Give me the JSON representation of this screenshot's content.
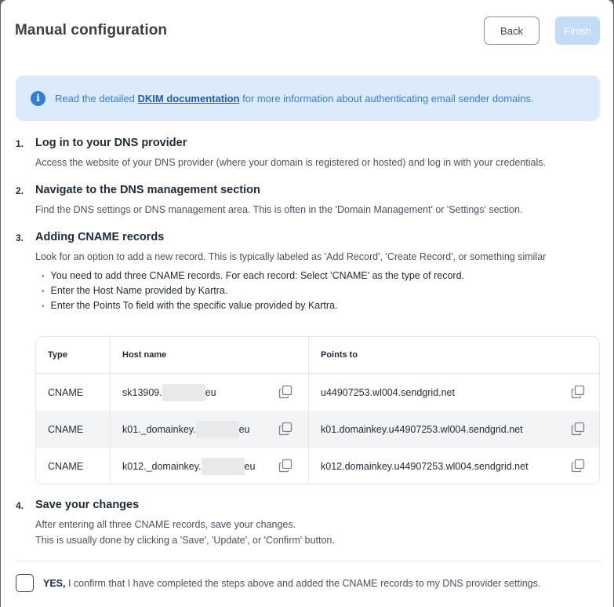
{
  "header": {
    "title": "Manual configuration",
    "back_label": "Back",
    "finish_label": "Finish"
  },
  "info": {
    "icon": "info-icon",
    "before": "Read the detailed ",
    "link": "DKIM documentation",
    "after": " for more information about authenticating email sender domains."
  },
  "steps": [
    {
      "num": "1.",
      "title": "Log in to your DNS provider",
      "desc": "Access the website of your DNS provider (where your domain is registered or hosted) and log in with your credentials."
    },
    {
      "num": "2.",
      "title": "Navigate to the DNS management section",
      "desc": "Find the DNS settings or DNS management area. This is often in the 'Domain Management' or 'Settings' section."
    },
    {
      "num": "3.",
      "title": "Adding CNAME records",
      "desc": "Look for an option to add a new record. This is typically labeled as 'Add Record', 'Create Record', or something similar",
      "bullets": [
        "You need to add three CNAME records. For each record: Select 'CNAME' as the type of record.",
        "Enter the Host Name provided by Kartra.",
        "Enter the Points To field with the specific value provided by Kartra."
      ]
    },
    {
      "num": "4.",
      "title": "Save your changes",
      "desc_lines": [
        "After entering all three CNAME records, save your changes.",
        "This is usually done by clicking a 'Save', 'Update', or 'Confirm' button."
      ]
    }
  ],
  "table": {
    "headers": [
      "Type",
      "Host name",
      "Points to"
    ],
    "rows": [
      {
        "type": "CNAME",
        "host_prefix": "sk13909.",
        "host_suffix": "eu",
        "points_to": "u44907253.wl004.sendgrid.net"
      },
      {
        "type": "CNAME",
        "host_prefix": "k01._domainkey.",
        "host_suffix": "eu",
        "points_to": "k01.domainkey.u44907253.wl004.sendgrid.net"
      },
      {
        "type": "CNAME",
        "host_prefix": "k012._domainkey.",
        "host_suffix": "eu",
        "points_to": "k012.domainkey.u44907253.wl004.sendgrid.net"
      }
    ],
    "copy_icon": "copy-icon"
  },
  "confirm": {
    "yes": "YES,",
    "text": " I confirm that I have completed the steps above and added the CNAME records to my DNS provider settings.",
    "checked": false
  },
  "colors": {
    "accent": "#2f7fd6",
    "info_bg": "#dcebfb",
    "finish_disabled": "#c2dcf7"
  }
}
